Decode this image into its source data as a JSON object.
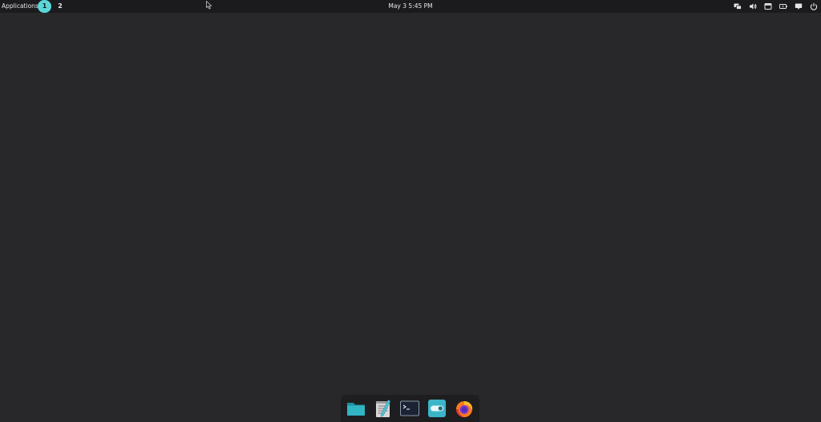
{
  "top_panel": {
    "applications_label": "Applications",
    "workspaces": [
      {
        "label": "1",
        "active": true
      },
      {
        "label": "2",
        "active": false
      }
    ],
    "clock": "May 3  5:45 PM",
    "tray_icons": [
      "network-icon",
      "volume-icon",
      "notifications-icon",
      "battery-icon",
      "display-icon",
      "power-icon"
    ]
  },
  "dock": {
    "items": [
      {
        "name": "files",
        "icon": "folder-icon"
      },
      {
        "name": "text-editor",
        "icon": "text-editor-icon"
      },
      {
        "name": "terminal",
        "icon": "terminal-icon"
      },
      {
        "name": "settings",
        "icon": "toggle-settings-icon"
      },
      {
        "name": "firefox",
        "icon": "firefox-icon"
      }
    ]
  },
  "colors": {
    "desktop_bg": "#28282b",
    "panel_bg": "#1b1b1d",
    "accent": "#5ad6d8",
    "dock_bg": "#1e1e20"
  }
}
